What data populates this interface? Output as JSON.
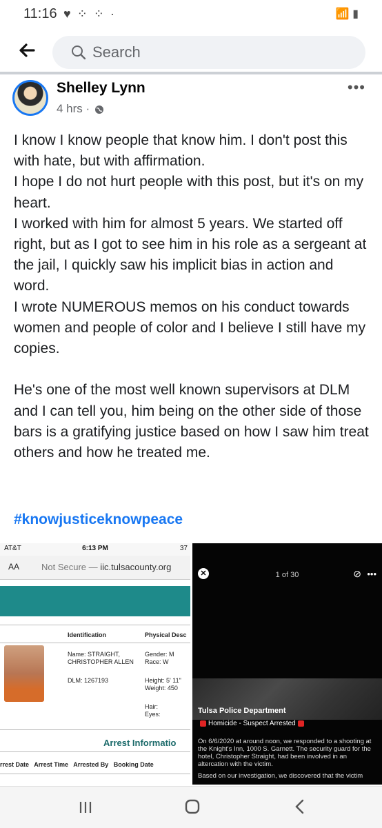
{
  "status_bar": {
    "time": "11:16",
    "left_icons": "♥ ⁘ ⁘ ·",
    "right_icons": "📶 ▮"
  },
  "search": {
    "placeholder": "Search"
  },
  "post": {
    "author": "Shelley Lynn",
    "time": "4 hrs",
    "meta_separator": "·",
    "more": "•••",
    "paragraphs": [
      "I know I know people that know him. I don't post this with hate, but with affirmation.",
      "I hope I do not hurt people with this post, but it's on my heart.",
      "I worked with him for almost 5 years. We started off right, but as I got to see him in his role as a sergeant at the jail, I quickly saw his implicit bias in action and word.",
      "I wrote NUMEROUS memos on his conduct towards women and people of color and I believe I still have my copies.",
      "",
      "He's one of the most well known supervisors at DLM and I can tell you, him being on the other side of those bars is a gratifying justice based on how I saw him treat others and how he treated me."
    ],
    "hashtag": "#knowjusticeknowpeace"
  },
  "image_left": {
    "carrier": "AT&T",
    "time": "6:13 PM",
    "battery": "37",
    "aa": "AA",
    "not_secure": "Not Secure —",
    "url": "iic.tulsacounty.org",
    "col_identification": "Identification",
    "col_physical": "Physical Desc",
    "name_label": "Name: STRAIGHT,\nCHRISTOPHER ALLEN",
    "dlm": "DLM: 1267193",
    "gender": "Gender: M\nRace: W",
    "height": "Height: 5' 11\"\nWeight: 450",
    "hair": "Hair:\nEyes:",
    "arrest_info": "Arrest Informatio",
    "table_headers": "rrest Date   Arrest Time   Arrested By   Booking Date"
  },
  "image_right": {
    "close": "✕",
    "counter": "1 of 30",
    "tag": "⊘",
    "more": "•••",
    "title": "Tulsa Police Department",
    "subtitle": "Homicide - Suspect Arrested",
    "body": "On 6/6/2020 at around noon, we responded to a shooting at the Knight's Inn, 1000 S. Garnett. The security guard for the hotel, Christopher Straight, had been involved in an altercation with the victim.",
    "body2": "Based on our investigation, we discovered that the victim"
  },
  "colors": {
    "accent": "#1877f2",
    "teal": "#1e8a8a"
  }
}
